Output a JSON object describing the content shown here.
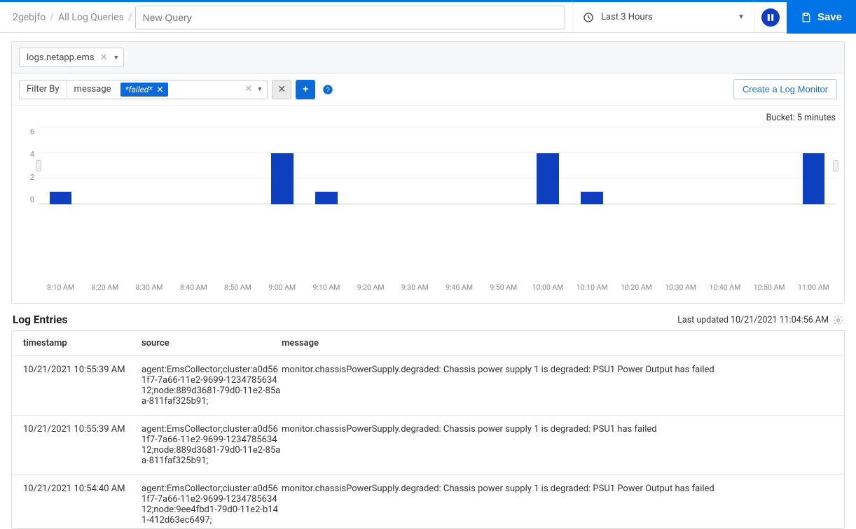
{
  "breadcrumb": {
    "root": "2gebjfo",
    "section": "All Log Queries"
  },
  "query_name_placeholder": "New Query",
  "time_range": "Last 3 Hours",
  "save_label": "Save",
  "source_chip": "logs.netapp.ems",
  "filter": {
    "by_label": "Filter By",
    "attribute": "message",
    "value": "*failed*"
  },
  "create_monitor": "Create a Log Monitor",
  "bucket_label": "Bucket: 5 minutes",
  "chart_data": {
    "type": "bar",
    "ylabel": "",
    "ylim": [
      0,
      6
    ],
    "y_ticks": [
      0,
      2,
      4,
      6
    ],
    "categories": [
      "8:10 AM",
      "8:20 AM",
      "8:30 AM",
      "8:40 AM",
      "8:50 AM",
      "9:00 AM",
      "9:10 AM",
      "9:20 AM",
      "9:30 AM",
      "9:40 AM",
      "9:50 AM",
      "10:00 AM",
      "10:10 AM",
      "10:20 AM",
      "10:30 AM",
      "10:40 AM",
      "10:50 AM",
      "11:00 AM"
    ],
    "values": [
      1,
      0,
      0,
      0,
      0,
      4,
      1,
      0,
      0,
      0,
      0,
      4,
      1,
      0,
      0,
      0,
      0,
      4
    ]
  },
  "entries": {
    "title": "Log Entries",
    "updated": "Last updated 10/21/2021 11:04:56 AM",
    "columns": {
      "ts": "timestamp",
      "src": "source",
      "msg": "message"
    },
    "rows": [
      {
        "ts": "10/21/2021 10:55:39 AM",
        "src": "agent:EmsCollector;cluster:a0d561f7-7a66-11e2-9699-123478563412;node:889d3681-79d0-11e2-85aa-811faf325b91;",
        "msg": "monitor.chassisPowerSupply.degraded: Chassis power supply 1 is degraded: PSU1 Power Output has failed"
      },
      {
        "ts": "10/21/2021 10:55:39 AM",
        "src": "agent:EmsCollector;cluster:a0d561f7-7a66-11e2-9699-123478563412;node:889d3681-79d0-11e2-85aa-811faf325b91;",
        "msg": "monitor.chassisPowerSupply.degraded: Chassis power supply 1 is degraded: PSU1 has failed"
      },
      {
        "ts": "10/21/2021 10:54:40 AM",
        "src": "agent:EmsCollector;cluster:a0d561f7-7a66-11e2-9699-123478563412;node:9ee4fbd1-79d0-11e2-b141-412d63ec6497;",
        "msg": "monitor.chassisPowerSupply.degraded: Chassis power supply 1 is degraded: PSU1 Power Output has failed"
      }
    ]
  }
}
